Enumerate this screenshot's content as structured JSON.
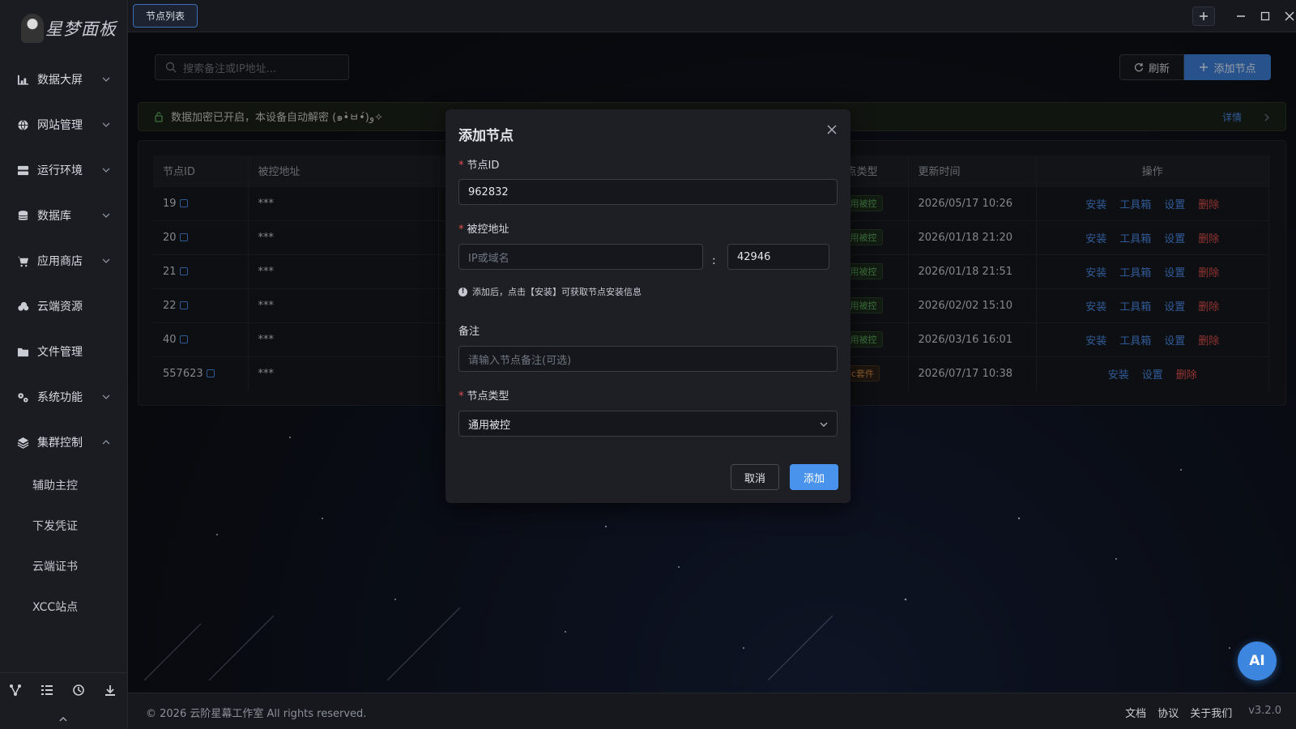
{
  "app": {
    "logo_text": "星梦面板"
  },
  "sidebar": {
    "items": [
      {
        "label": "数据大屏",
        "icon": "chart-bar-icon",
        "expandable": true
      },
      {
        "label": "网站管理",
        "icon": "globe-icon",
        "expandable": true
      },
      {
        "label": "运行环境",
        "icon": "server-icon",
        "expandable": true
      },
      {
        "label": "数据库",
        "icon": "database-icon",
        "expandable": true
      },
      {
        "label": "应用商店",
        "icon": "cart-icon",
        "expandable": true
      },
      {
        "label": "云端资源",
        "icon": "cloud-icon",
        "expandable": false
      },
      {
        "label": "文件管理",
        "icon": "folder-icon",
        "expandable": false
      },
      {
        "label": "系统功能",
        "icon": "gears-icon",
        "expandable": true
      },
      {
        "label": "集群控制",
        "icon": "layers-icon",
        "expandable": true,
        "expanded": true
      }
    ],
    "sub_items": [
      "辅助主控",
      "下发凭证",
      "云端证书",
      "XCC站点"
    ],
    "bottom_icons": [
      "cluster-icon",
      "list-icon",
      "history-icon",
      "download-icon"
    ]
  },
  "topbar": {
    "active_tab": "节点列表"
  },
  "toolbar": {
    "search_placeholder": "搜索备注或IP地址...",
    "refresh_label": "刷新",
    "add_node_label": "添加节点"
  },
  "notice": {
    "text": "数据加密已开启，本设备自动解密 (๑•̀ㅂ•́)و✧",
    "detail_label": "详情"
  },
  "table": {
    "headers": [
      "节点ID",
      "被控地址",
      "",
      "节点类型",
      "更新时间",
      "操作"
    ],
    "rows": [
      {
        "id": "19",
        "address": "***",
        "type": "通用被控",
        "type_style": "green",
        "updated": "2026/05/17 10:26",
        "ops": [
          "安装",
          "工具箱",
          "设置",
          "删除"
        ]
      },
      {
        "id": "20",
        "address": "***",
        "type": "通用被控",
        "type_style": "green",
        "updated": "2026/01/18 21:20",
        "ops": [
          "安装",
          "工具箱",
          "设置",
          "删除"
        ]
      },
      {
        "id": "21",
        "address": "***",
        "type": "通用被控",
        "type_style": "green",
        "updated": "2026/01/18 21:51",
        "ops": [
          "安装",
          "工具箱",
          "设置",
          "删除"
        ]
      },
      {
        "id": "22",
        "address": "***",
        "type": "通用被控",
        "type_style": "green",
        "updated": "2026/02/02 15:10",
        "ops": [
          "安装",
          "工具箱",
          "设置",
          "删除"
        ]
      },
      {
        "id": "40",
        "address": "***",
        "type": "通用被控",
        "type_style": "green",
        "updated": "2026/03/16 16:01",
        "ops": [
          "安装",
          "工具箱",
          "设置",
          "删除"
        ]
      },
      {
        "id": "557623",
        "address": "***",
        "type": "xcc套件",
        "type_style": "orange",
        "updated": "2026/07/17 10:38",
        "ops": [
          "安装",
          "设置",
          "删除"
        ]
      }
    ]
  },
  "modal": {
    "title": "添加节点",
    "node_id_label": "节点ID",
    "node_id_value": "962832",
    "address_label": "被控地址",
    "address_placeholder": "IP或域名",
    "colon": ":",
    "port_value": "42946",
    "hint": "添加后，点击【安装】可获取节点安装信息",
    "remark_label": "备注",
    "remark_placeholder": "请输入节点备注(可选)",
    "type_label": "节点类型",
    "type_value": "通用被控",
    "cancel_label": "取消",
    "confirm_label": "添加"
  },
  "footer": {
    "copyright": "© 2026 云阶星幕工作室 All rights reserved.",
    "links": [
      "文档",
      "协议",
      "关于我们"
    ],
    "version": "v3.2.0"
  },
  "ai_button": {
    "label": "AI"
  },
  "colors": {
    "accent": "#4a93ec",
    "danger": "#e0504e",
    "success": "#5fae5f",
    "warning": "#d58b44"
  }
}
